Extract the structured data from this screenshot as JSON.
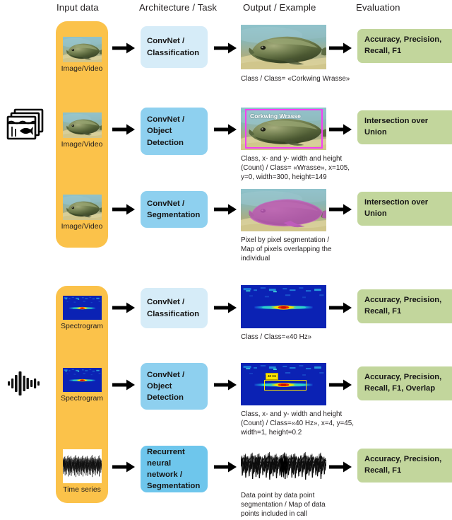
{
  "headers": [
    {
      "label": "Input data"
    },
    {
      "label": "Architecture / Task"
    },
    {
      "label": "Output / Example"
    },
    {
      "label": "Evaluation"
    }
  ],
  "modalities": [
    {
      "icon": "video-frames-fish-icon",
      "label": "video / image stack"
    },
    {
      "icon": "audio-waveform-icon",
      "label": "audio waveform"
    }
  ],
  "rows": [
    {
      "input_label": "Image/Video",
      "input_thumb": "fish-photo-thumbnail",
      "arch_label": "ConvNet /\nClassification",
      "arch_color": "#d6ecf8",
      "output_thumb": "fish-photo-output",
      "output_caption": "Class / Class= «Corkwing Wrasse»",
      "eval_label": "Accuracy, Precision,\nRecall, F1",
      "overlay": {
        "type": "none"
      }
    },
    {
      "input_label": "Image/Video",
      "input_thumb": "fish-photo-thumbnail",
      "arch_label": "ConvNet /\nObject\nDetection",
      "arch_color": "#8ed0ef",
      "output_thumb": "fish-photo-output-bbox",
      "output_caption": "Class, x- and y- width and height\n(Count) / Class= «Wrasse», x=105,\ny=0, width=300, height=149",
      "eval_label": "Intersection over\nUnion",
      "overlay": {
        "type": "bbox-magenta",
        "label": "Corkwing Wrasse"
      }
    },
    {
      "input_label": "Image/Video",
      "input_thumb": "fish-photo-thumbnail",
      "arch_label": "ConvNet /\nSegmentation",
      "arch_color": "#8ed0ef",
      "output_thumb": "fish-photo-output-mask",
      "output_caption": "Pixel by pixel segmentation /\nMap of pixels overlapping the\nindividual",
      "eval_label": "Intersection over\nUnion",
      "overlay": {
        "type": "segmentation-mask",
        "color": "#c35cc0"
      }
    },
    {
      "input_label": "Spectrogram",
      "input_thumb": "spectrogram-thumbnail",
      "arch_label": "ConvNet /\nClassification",
      "arch_color": "#d6ecf8",
      "output_thumb": "spectrogram-output",
      "output_caption": "Class / Class=«40 Hz»",
      "eval_label": "Accuracy, Precision,\nRecall, F1",
      "overlay": {
        "type": "none"
      }
    },
    {
      "input_label": "Spectrogram",
      "input_thumb": "spectrogram-thumbnail",
      "arch_label": "ConvNet /\nObject\nDetection",
      "arch_color": "#8ed0ef",
      "output_thumb": "spectrogram-output-bbox",
      "output_caption": "Class, x- and y- width and height\n(Count) / Class=«40 Hz», x=4, y=45,\nwidth=1, height=0.2",
      "eval_label": "Accuracy, Precision,\nRecall, F1, Overlap",
      "overlay": {
        "type": "bbox-yellow",
        "label": "40 Hz"
      }
    },
    {
      "input_label": "Time series",
      "input_thumb": "timeseries-thumbnail",
      "arch_label": "Recurrent neural\nnetwork /\nSegmentation",
      "arch_color": "#6ec6ec",
      "output_thumb": "timeseries-output",
      "output_caption": "Data point by data point\nsegmentation / Map of data\npoints included in call",
      "eval_label": "Accuracy, Precision,\nRecall, F1",
      "overlay": {
        "type": "timeseries-highlight",
        "color": "#ee1b24"
      }
    }
  ],
  "colors": {
    "input_column": "#fbc24a",
    "arch_light": "#d6ecf8",
    "arch_mid": "#8ed0ef",
    "arch_strong": "#6ec6ec",
    "evaluation": "#c2d69c",
    "bbox_magenta": "#f43ff4",
    "bbox_yellow": "#ffe600",
    "mask_magenta": "#c35cc0",
    "highlight_red": "#ee1b24",
    "arrow": "#000000"
  }
}
